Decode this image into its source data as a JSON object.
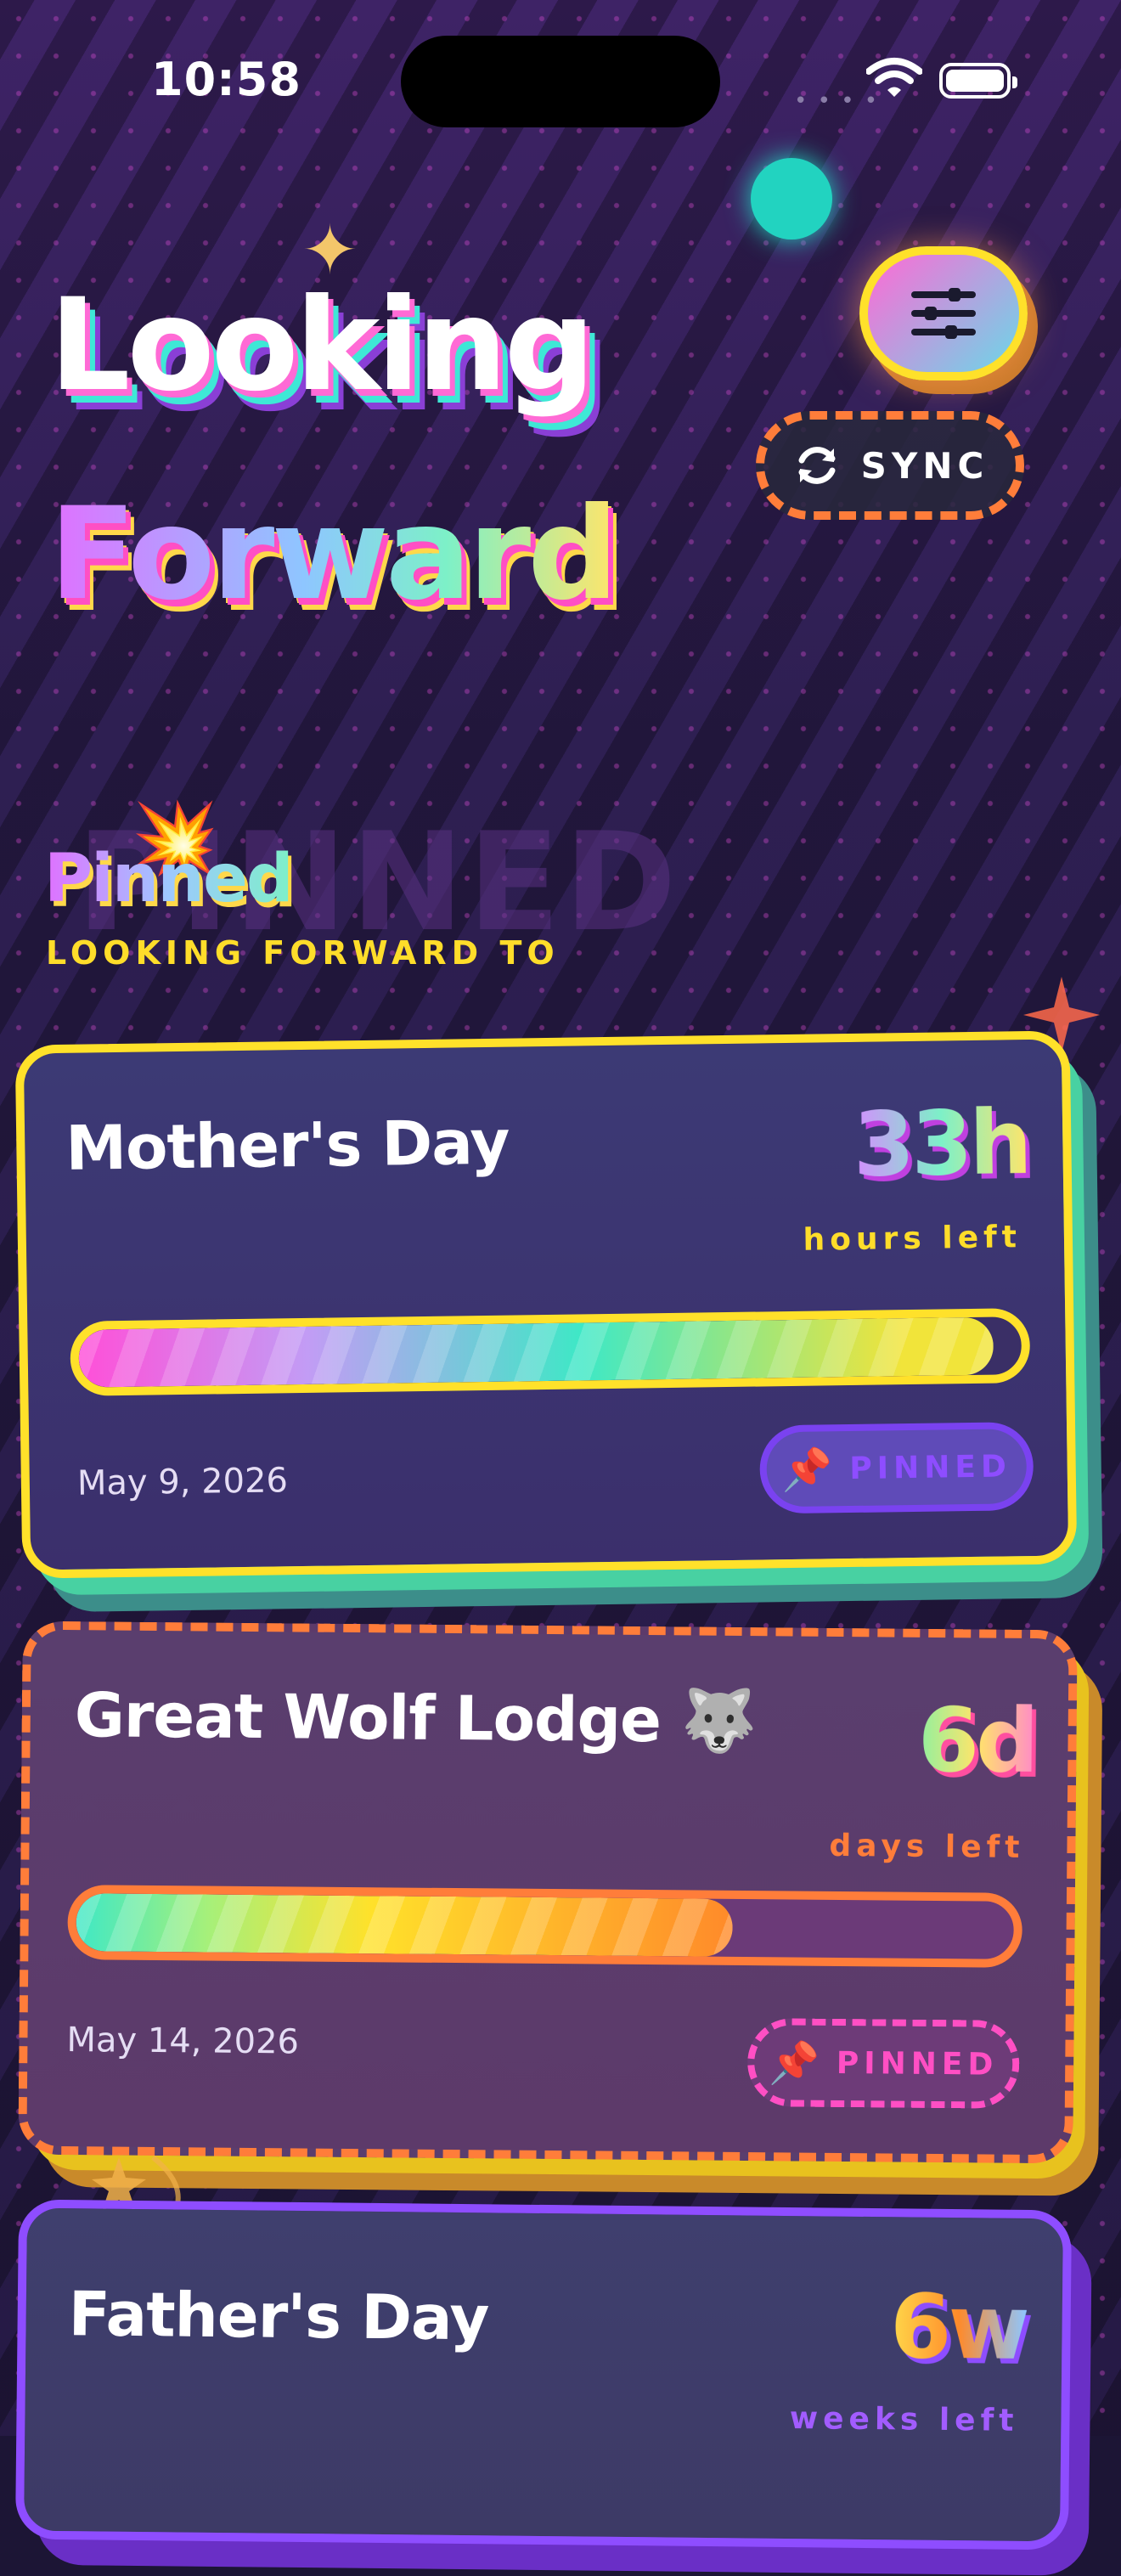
{
  "status_bar": {
    "time": "10:58"
  },
  "header": {
    "title_line1": "Looking",
    "title_line2": "Forward",
    "sync_label": "SYNC"
  },
  "section": {
    "ghost": "PINNED",
    "title": "Pinned",
    "subtitle": "LOOKING FORWARD TO"
  },
  "events": [
    {
      "name": "Mother's Day",
      "count": "33h",
      "unit": "hours left",
      "date": "May 9, 2026",
      "pin_label": "PINNED",
      "progress": 0.97
    },
    {
      "name": "Great Wolf Lodge 🐺",
      "count": "6d",
      "unit": "days left",
      "date": "May 14, 2026",
      "pin_label": "PINNED",
      "progress": 0.7
    },
    {
      "name": "Father's Day",
      "count": "6w",
      "unit": "weeks left"
    }
  ],
  "icons": {
    "filter": "sliders-icon",
    "sync": "sync-icon",
    "pin": "pushpin-icon",
    "sparkle": "sparkle-icon",
    "burst": "explosion-icon"
  },
  "colors": {
    "accent_yellow": "#ffe12a",
    "accent_orange": "#ff7d3a",
    "accent_pink": "#ff4fc4",
    "accent_teal": "#3ee8d6",
    "accent_purple": "#8e4dff"
  }
}
